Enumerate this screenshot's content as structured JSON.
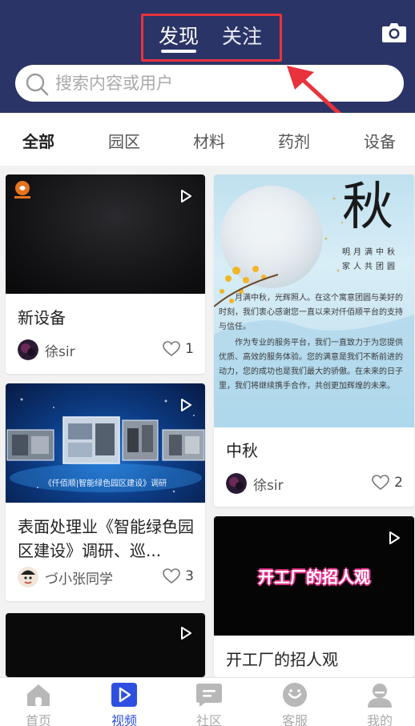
{
  "header": {
    "tabs": [
      {
        "label": "发现"
      },
      {
        "label": "关注"
      }
    ],
    "search_placeholder": "搜索内容或用户"
  },
  "categories": [
    {
      "label": "全部",
      "active": true
    },
    {
      "label": "园区"
    },
    {
      "label": "材料"
    },
    {
      "label": "药剂"
    },
    {
      "label": "设备"
    }
  ],
  "feed": {
    "left": [
      {
        "title": "新设备",
        "author": "徐sir",
        "likes": "1"
      },
      {
        "title": "表面处理业《智能绿色园区建设》调研、巡...",
        "author": "づ小张同学",
        "likes": "3",
        "thumb_text": "《仟佰顺|智能绿色园区建设》调研"
      },
      {
        "title": ""
      }
    ],
    "right": [
      {
        "title": "中秋",
        "author": "徐sir",
        "likes": "2",
        "poster": {
          "big_char": "秋",
          "vertical_lines": [
            "明月满中秋",
            "家人共团圆"
          ],
          "paragraphs": [
            "月满中秋，光辉照人。在这个寓意团圆与美好的时刻，我们衷心感谢您一直以来对仟佰顺平台的支持与信任。",
            "作为专业的服务平台，我们一直致力于为您提供优质、高效的服务体验。您的满意是我们不断前进的动力，您的成功也是我们最大的骄傲。在未来的日子里，我们将继续携手合作，共创更加辉煌的未来。"
          ]
        }
      },
      {
        "title": "开工厂的招人观",
        "thumb_text": "开工厂的招人观"
      }
    ]
  },
  "nav": [
    {
      "label": "首页"
    },
    {
      "label": "视频",
      "active": true
    },
    {
      "label": "社区"
    },
    {
      "label": "客服"
    },
    {
      "label": "我的"
    }
  ],
  "colors": {
    "header_bg": "#2b3466",
    "accent": "#2f4fe0",
    "highlight_border": "#e8323c"
  }
}
